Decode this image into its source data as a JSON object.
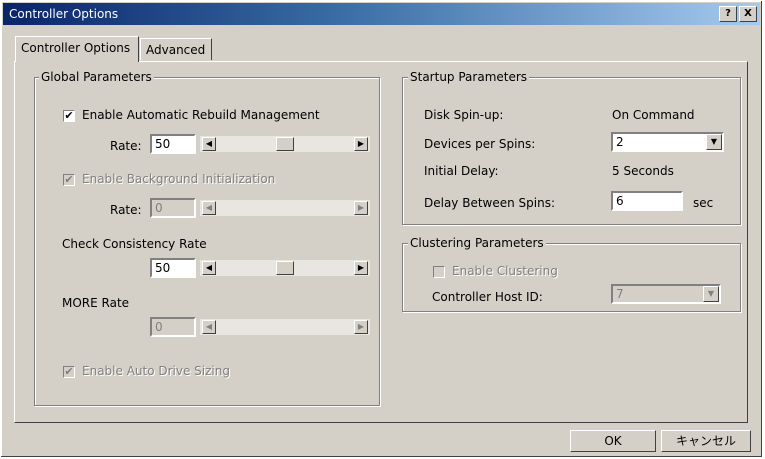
{
  "window": {
    "title": "Controller Options",
    "help_label": "?",
    "close_label": "X"
  },
  "tabs": [
    {
      "label": "Controller Options",
      "active": true
    },
    {
      "label": "Advanced",
      "active": false
    }
  ],
  "global": {
    "legend": "Global Parameters",
    "rebuild": {
      "label": "Enable Automatic Rebuild Management",
      "checked": true,
      "rate_label": "Rate:",
      "rate_value": "50",
      "slider_level": 0.5
    },
    "background_init": {
      "label": "Enable Background Initialization",
      "checked": true,
      "disabled": true,
      "rate_label": "Rate:",
      "rate_value": "0",
      "slider_level": 0
    },
    "check_consistency": {
      "label": "Check Consistency Rate",
      "value": "50",
      "slider_level": 0.5
    },
    "more": {
      "label": "MORE Rate",
      "value": "0",
      "slider_level": 0
    },
    "auto_drive_sizing": {
      "label": "Enable Auto Drive Sizing",
      "checked": true,
      "disabled": true
    }
  },
  "startup": {
    "legend": "Startup Parameters",
    "spin_up_label": "Disk Spin-up:",
    "spin_up_value": "On Command",
    "devices_label": "Devices per Spins:",
    "devices_value": "2",
    "initial_delay_label": "Initial Delay:",
    "initial_delay_value": "5 Seconds",
    "delay_between_label": "Delay Between Spins:",
    "delay_between_value": "6",
    "delay_unit": "sec"
  },
  "clustering": {
    "legend": "Clustering Parameters",
    "enable_label": "Enable Clustering",
    "enable_checked": false,
    "host_id_label": "Controller Host ID:",
    "host_id_value": "7"
  },
  "footer": {
    "ok_label": "OK",
    "cancel_label": "キャンセル"
  },
  "icons": {
    "checkmark": "✔",
    "arrow_left": "◀",
    "arrow_right": "▶",
    "dropdown": "▼"
  }
}
